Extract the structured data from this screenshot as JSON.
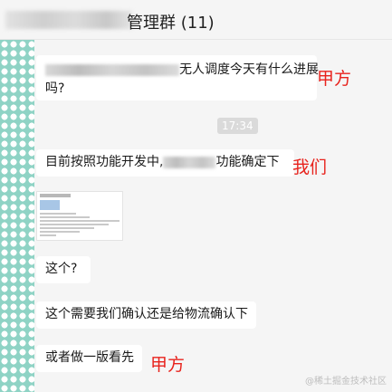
{
  "header": {
    "title": "管理群 (11)"
  },
  "messages": [
    {
      "text_suffix": "无人调度今天有什么进展",
      "text_line2": "吗?"
    },
    {
      "text_prefix": "目前按照功能开发中,",
      "text_suffix": "功能确定下"
    },
    {
      "image_alt": "screenshot"
    },
    {
      "text": "这个?"
    },
    {
      "text": "这个需要我们确认还是给物流确认下"
    },
    {
      "text": "或者做一版看先"
    }
  ],
  "timestamp": "17:34",
  "annotations": {
    "party_a_1": "甲方",
    "we": "我们",
    "party_a_2": "甲方"
  },
  "watermark": "@稀土掘金技术社区",
  "colors": {
    "annotation": "#e8231d",
    "dots_bg": "#8fd3c5",
    "bubble_bg": "#ffffff",
    "page_bg": "#f5f5f5"
  }
}
